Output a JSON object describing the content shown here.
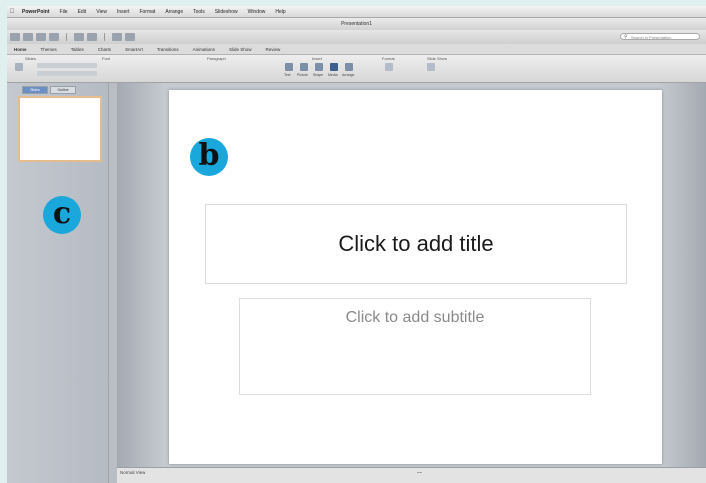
{
  "menubar": {
    "app_name": "PowerPoint",
    "items": [
      "File",
      "Edit",
      "View",
      "Insert",
      "Format",
      "Arrange",
      "Tools",
      "Slideshow",
      "Window",
      "Help"
    ]
  },
  "window": {
    "title": "Presentation1"
  },
  "toolbar": {
    "search_placeholder": "Search in Presentation"
  },
  "ribbon": {
    "tabs": [
      "Home",
      "Themes",
      "Tables",
      "Charts",
      "SmartArt",
      "Transitions",
      "Animations",
      "Slide Show",
      "Review"
    ],
    "groups": [
      "Slides",
      "Font",
      "Paragraph",
      "Insert",
      "Format",
      "Slide Show"
    ],
    "insert_items": [
      "Text",
      "Picture",
      "Shape",
      "Media",
      "Arrange"
    ]
  },
  "side_panel": {
    "tabs": [
      "Slides",
      "Outline"
    ]
  },
  "slide": {
    "title_placeholder": "Click to add title",
    "subtitle_placeholder": "Click to add subtitle"
  },
  "statusbar": {
    "left_text": "Normal View",
    "center_text": "—"
  },
  "markers": {
    "b": "b",
    "c": "c"
  },
  "colors": {
    "marker": "#1aa7dc",
    "thumb_border": "#e6bc8c",
    "background": "#dff0ee"
  }
}
